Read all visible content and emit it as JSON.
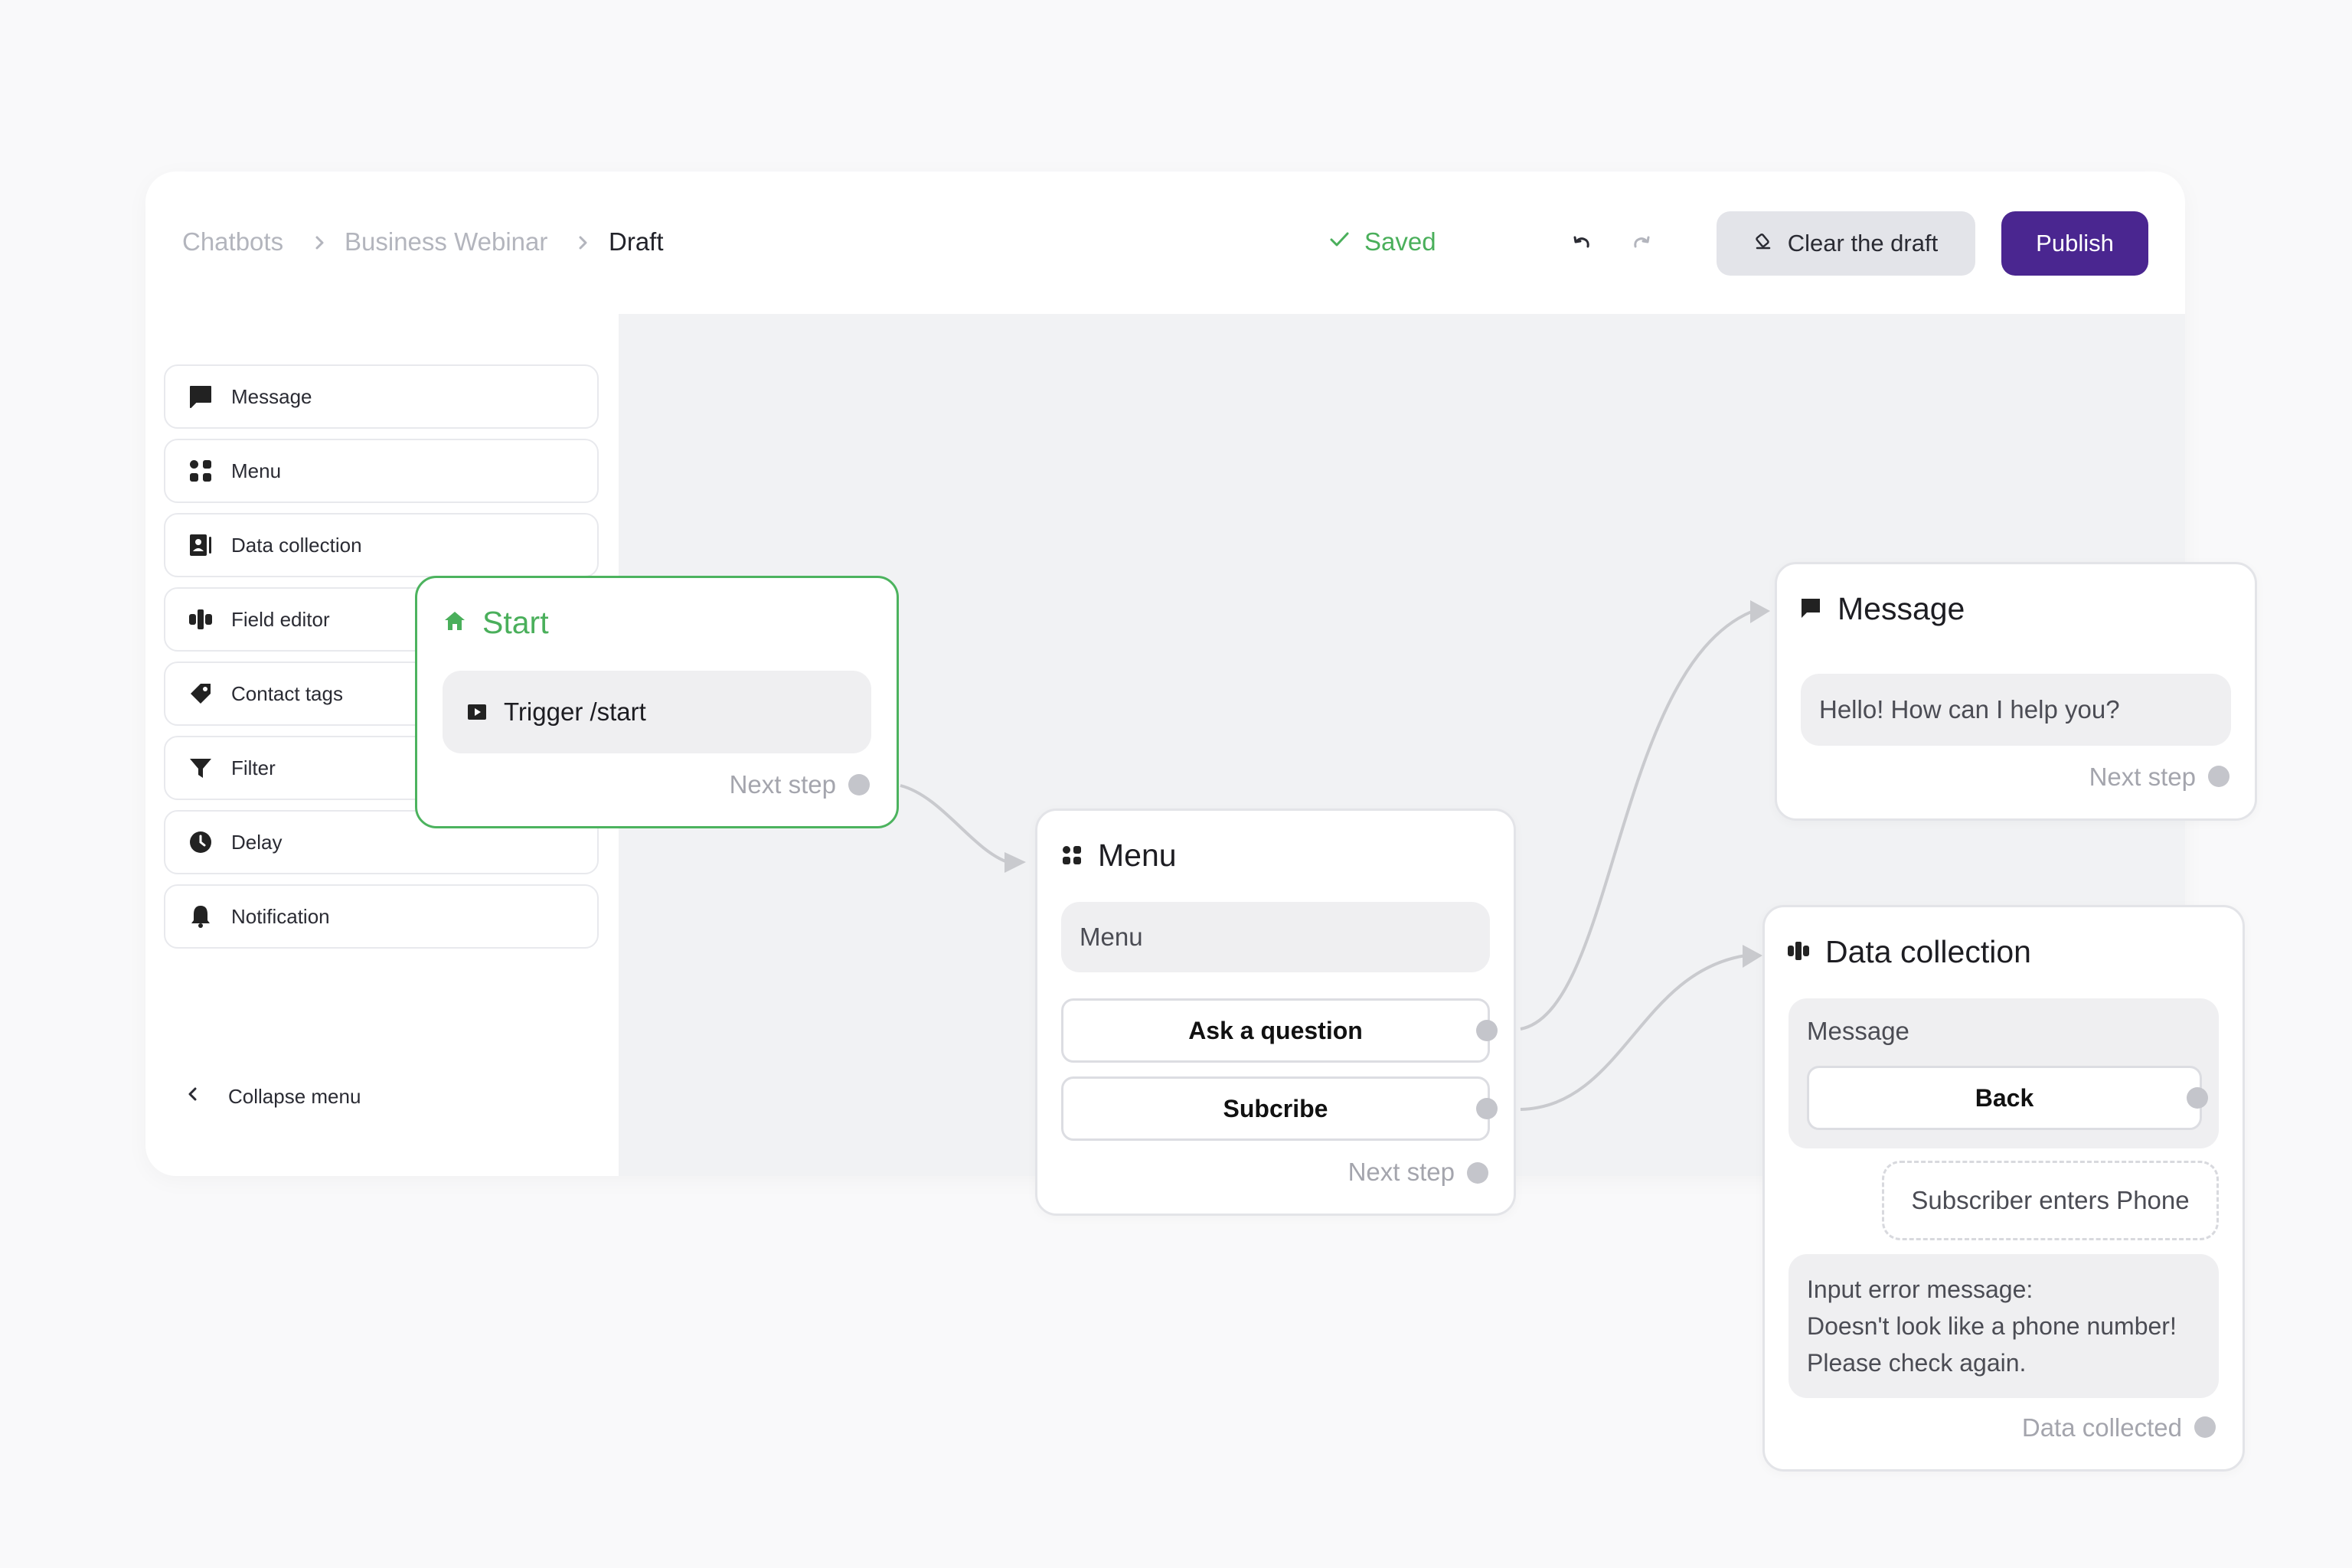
{
  "breadcrumb": {
    "root": "Chatbots",
    "bot": "Business Webinar",
    "current": "Draft"
  },
  "status": {
    "saved": "Saved"
  },
  "toolbar": {
    "clear_draft": "Clear the draft",
    "publish": "Publish"
  },
  "sidebar": {
    "items": [
      {
        "label": "Message",
        "icon": "speech-bubble-icon"
      },
      {
        "label": "Menu",
        "icon": "grid-dots-icon"
      },
      {
        "label": "Data collection",
        "icon": "contact-card-icon"
      },
      {
        "label": "Field editor",
        "icon": "field-editor-icon"
      },
      {
        "label": "Contact tags",
        "icon": "tag-icon"
      },
      {
        "label": "Filter",
        "icon": "funnel-icon"
      },
      {
        "label": "Delay",
        "icon": "clock-icon"
      },
      {
        "label": "Notification",
        "icon": "bell-icon"
      }
    ],
    "collapse": "Collapse menu"
  },
  "nodes": {
    "start": {
      "title": "Start",
      "trigger": "Trigger /start",
      "next": "Next step"
    },
    "menu": {
      "title": "Menu",
      "text": "Menu",
      "options": [
        "Ask a question",
        "Subcribe"
      ],
      "next": "Next step"
    },
    "message": {
      "title": "Message",
      "text": "Hello! How can I help you?",
      "next": "Next step"
    },
    "data_collection": {
      "title": "Data collection",
      "message": "Message",
      "button": "Back",
      "input": "Subscriber enters Phone",
      "error_lines": [
        "Input error message:",
        "Doesn't look like a phone number!",
        "Please check again."
      ],
      "next": "Data collected"
    }
  },
  "colors": {
    "accent": "#4a2690",
    "success": "#4aaf5b",
    "canvas": "#f1f2f4",
    "port": "#c4c5cb"
  }
}
